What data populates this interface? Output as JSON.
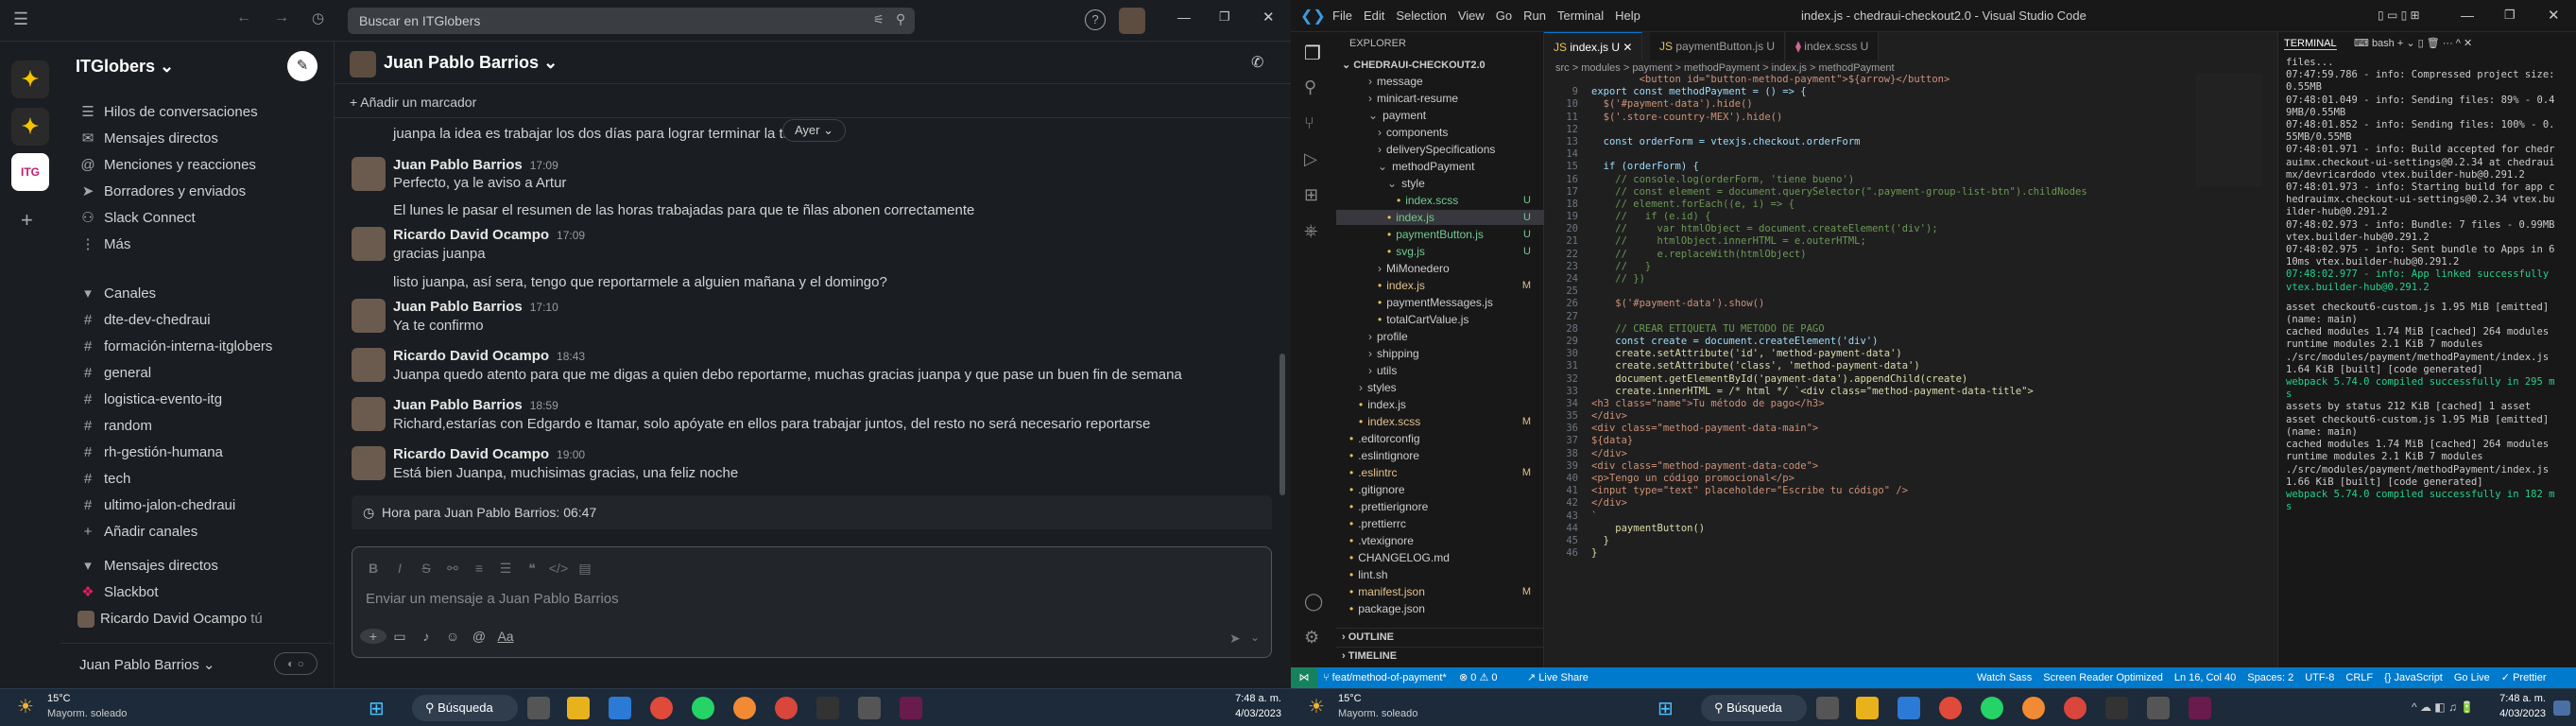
{
  "slack": {
    "search_placeholder": "Buscar en ITGlobers",
    "workspace": "ITGlobers",
    "nav": [
      "Hilos de conversaciones",
      "Mensajes directos",
      "Menciones y reacciones",
      "Borradores y enviados",
      "Slack Connect",
      "Más"
    ],
    "channels_header": "Canales",
    "channels": [
      "dte-dev-chedraui",
      "formación-interna-itglobers",
      "general",
      "logistica-evento-itg",
      "random",
      "rh-gestión-humana",
      "tech",
      "ultimo-jalon-chedraui"
    ],
    "add_channels": "Añadir canales",
    "dm_header": "Mensajes directos",
    "dms": [
      "Slackbot",
      "Ricardo David Ocampo"
    ],
    "dm_you": "tú",
    "user": "Juan Pablo Barrios",
    "channel_title": "Juan Pablo Barrios",
    "bookmark": "Añadir un marcador",
    "date_pill": "Ayer",
    "messages": [
      {
        "text": "juanpa la idea es trabajar los dos días para lograr terminar la tar"
      },
      {
        "name": "Juan Pablo Barrios",
        "time": "17:09",
        "text": "Perfecto, ya le aviso a Artur"
      },
      {
        "text": "El lunes le pasar el resumen de las horas trabajadas para que te ñlas abonen correctamente"
      },
      {
        "name": "Ricardo David Ocampo",
        "time": "17:09",
        "text": "gracias juanpa"
      },
      {
        "text": "listo juanpa, así sera, tengo que reportarmele a alguien mañana y el domingo?"
      },
      {
        "name": "Juan Pablo Barrios",
        "time": "17:10",
        "text": "Ya te confirmo"
      },
      {
        "name": "Ricardo David Ocampo",
        "time": "18:43",
        "text": "Juanpa quedo atento para que me digas a quien debo reportarme, muchas gracias juanpa y que pase un buen fin de semana"
      },
      {
        "name": "Juan Pablo Barrios",
        "time": "18:59",
        "text": "Richard,estarías con Edgardo e Itamar, solo apóyate en ellos para trabajar juntos, del resto no será necesario reportarse"
      },
      {
        "name": "Ricardo David Ocampo",
        "time": "19:00",
        "text": "Está bien Juanpa, muchisimas gracias, una feliz noche"
      }
    ],
    "local_time": "Hora para Juan Pablo Barrios: 06:47",
    "composer_placeholder": "Enviar un mensaje a Juan Pablo Barrios"
  },
  "vscode": {
    "menu": [
      "File",
      "Edit",
      "Selection",
      "View",
      "Go",
      "Run",
      "Terminal",
      "Help"
    ],
    "title": "index.js - chedraui-checkout2.0 - Visual Studio Code",
    "explorer_label": "EXPLORER",
    "project": "CHEDRAUI-CHECKOUT2.0",
    "tabs": [
      "index.js  U",
      "paymentButton.js  U",
      "index.scss  U"
    ],
    "breadcrumb": "src > modules > payment > methodPayment > index.js > methodPayment",
    "tree": [
      {
        "t": "message",
        "d": 1,
        "f": true
      },
      {
        "t": "minicart-resume",
        "d": 1,
        "f": true
      },
      {
        "t": "payment",
        "d": 1,
        "f": true,
        "open": true
      },
      {
        "t": "components",
        "d": 2,
        "f": true
      },
      {
        "t": "deliverySpecifications",
        "d": 2,
        "f": true
      },
      {
        "t": "methodPayment",
        "d": 2,
        "f": true,
        "open": true
      },
      {
        "t": "style",
        "d": 3,
        "f": true,
        "open": true
      },
      {
        "t": "index.scss",
        "d": 4,
        "g": "U"
      },
      {
        "t": "index.js",
        "d": 3,
        "g": "U",
        "sel": true
      },
      {
        "t": "paymentButton.js",
        "d": 3,
        "g": "U"
      },
      {
        "t": "svg.js",
        "d": 3,
        "g": "U"
      },
      {
        "t": "MiMonedero",
        "d": 2,
        "f": true
      },
      {
        "t": "index.js",
        "d": 2,
        "g": "M"
      },
      {
        "t": "paymentMessages.js",
        "d": 2
      },
      {
        "t": "totalCartValue.js",
        "d": 2
      },
      {
        "t": "profile",
        "d": 1,
        "f": true
      },
      {
        "t": "shipping",
        "d": 1,
        "f": true
      },
      {
        "t": "utils",
        "d": 1,
        "f": true
      },
      {
        "t": "styles",
        "d": 0,
        "f": true
      },
      {
        "t": "index.js",
        "d": 0
      },
      {
        "t": "index.scss",
        "d": 0,
        "g": "M"
      },
      {
        "t": ".editorconfig",
        "d": -1
      },
      {
        "t": ".eslintignore",
        "d": -1
      },
      {
        "t": ".eslintrc",
        "d": -1,
        "g": "M"
      },
      {
        "t": ".gitignore",
        "d": -1
      },
      {
        "t": ".prettierignore",
        "d": -1
      },
      {
        "t": ".prettierrc",
        "d": -1
      },
      {
        "t": ".vtexignore",
        "d": -1
      },
      {
        "t": "CHANGELOG.md",
        "d": -1
      },
      {
        "t": "lint.sh",
        "d": -1
      },
      {
        "t": "manifest.json",
        "d": -1,
        "g": "M"
      },
      {
        "t": "package.json",
        "d": -1
      }
    ],
    "outline": "OUTLINE",
    "timeline": "TIMELINE",
    "code_first": "        <button id=\"button-method-payment\">${arrow}</button>",
    "code": [
      {
        "n": "9",
        "c": "export const methodPayment = () => {"
      },
      {
        "n": "10",
        "c": "  $('#payment-data').hide()"
      },
      {
        "n": "11",
        "c": "  $('.store-country-MEX').hide()"
      },
      {
        "n": "12",
        "c": ""
      },
      {
        "n": "13",
        "c": "  const orderForm = vtexjs.checkout.orderForm"
      },
      {
        "n": "14",
        "c": ""
      },
      {
        "n": "15",
        "c": "  if (orderForm) {"
      },
      {
        "n": "16",
        "c": "    // console.log(orderForm, 'tiene bueno')"
      },
      {
        "n": "17",
        "c": "    // const element = document.querySelector(\".payment-group-list-btn\").childNodes"
      },
      {
        "n": "18",
        "c": "    // element.forEach((e, i) => {"
      },
      {
        "n": "19",
        "c": "    //   if (e.id) {"
      },
      {
        "n": "20",
        "c": "    //     var htmlObject = document.createElement('div');"
      },
      {
        "n": "21",
        "c": "    //     htmlObject.innerHTML = e.outerHTML;"
      },
      {
        "n": "22",
        "c": "    //     e.replaceWith(htmlObject)"
      },
      {
        "n": "23",
        "c": "    //   }"
      },
      {
        "n": "24",
        "c": "    // })"
      },
      {
        "n": "25",
        "c": ""
      },
      {
        "n": "26",
        "c": "    $('#payment-data').show()"
      },
      {
        "n": "27",
        "c": ""
      },
      {
        "n": "28",
        "c": "    // CREAR ETIQUETA TU METODO DE PAGO"
      },
      {
        "n": "29",
        "c": "    const create = document.createElement('div')"
      },
      {
        "n": "30",
        "c": "    create.setAttribute('id', 'method-payment-data')"
      },
      {
        "n": "31",
        "c": "    create.setAttribute('class', 'method-payment-data')"
      },
      {
        "n": "32",
        "c": "    document.getElementById('payment-data').appendChild(create)"
      },
      {
        "n": "33",
        "c": "    create.innerHTML = /* html */ `<div class=\"method-payment-data-title\">"
      },
      {
        "n": "34",
        "c": "<h3 class=\"name\">Tu método de pago</h3>"
      },
      {
        "n": "35",
        "c": "</div>"
      },
      {
        "n": "36",
        "c": "<div class=\"method-payment-data-main\">"
      },
      {
        "n": "37",
        "c": "${data}"
      },
      {
        "n": "38",
        "c": "</div>"
      },
      {
        "n": "39",
        "c": "<div class=\"method-payment-data-code\">"
      },
      {
        "n": "40",
        "c": "<p>Tengo un código promocional</p>"
      },
      {
        "n": "41",
        "c": "<input type=\"text\" placeholder=\"Escribe tu código\" />"
      },
      {
        "n": "42",
        "c": "</div>"
      },
      {
        "n": "43",
        "c": "`"
      },
      {
        "n": "44",
        "c": "    paymentButton()"
      },
      {
        "n": "45",
        "c": "  }"
      },
      {
        "n": "46",
        "c": "}"
      }
    ],
    "terminal_label": "TERMINAL",
    "terminal_shell": "bash",
    "terminal_lines": [
      "files...",
      "07:47:59.786 - info: Compressed project size: 0.55MB",
      "07:48:01.049 - info: Sending files: 89% - 0.49MB/0.55MB",
      "07:48:01.852 - info: Sending files: 100% - 0.55MB/0.55MB",
      "07:48:01.971 - info: Build accepted for chedrauimx.checkout-ui-settings@0.2.34 at chedrauimx/devricardodo vtex.builder-hub@0.291.2",
      "07:48:01.973 - info: Starting build for app chedrauimx.checkout-ui-settings@0.2.34 vtex.builder-hub@0.291.2",
      "07:48:02.973 - info: Bundle: 7 files - 0.99MB vtex.builder-hub@0.291.2",
      "07:48:02.975 - info: Sent bundle to Apps in 610ms vtex.builder-hub@0.291.2",
      "07:48:02.977 - info: App linked successfully vtex.builder-hub@0.291.2",
      "",
      "asset checkout6-custom.js 1.95 MiB [emitted] (name: main)",
      "cached modules 1.74 MiB [cached] 264 modules",
      "runtime modules 2.1 KiB 7 modules",
      "./src/modules/payment/methodPayment/index.js 1.64 KiB [built] [code generated]",
      "webpack 5.74.0 compiled successfully in 295 ms",
      "assets by status 212 KiB [cached] 1 asset",
      "asset checkout6-custom.js 1.95 MiB [emitted] (name: main)",
      "cached modules 1.74 MiB [cached] 264 modules",
      "runtime modules 2.1 KiB 7 modules",
      "./src/modules/payment/methodPayment/index.js 1.66 KiB [built] [code generated]",
      "webpack 5.74.0 compiled successfully in 182 ms"
    ],
    "status_left": "feat/method-of-payment*",
    "status_errors": "⊗ 0 ⚠ 0",
    "status_live": "Live Share",
    "status_right": [
      "Watch Sass",
      "Screen Reader Optimized",
      "Ln 16, Col 40",
      "Spaces: 2",
      "UTF-8",
      "CRLF",
      "{} JavaScript",
      "Go Live",
      "✓ Prettier"
    ]
  },
  "taskbar": {
    "weather_temp": "15°C",
    "weather_desc": "Mayorm. soleado",
    "search": "Búsqueda",
    "time": "7:48 a. m.",
    "date": "4/03/2023"
  }
}
